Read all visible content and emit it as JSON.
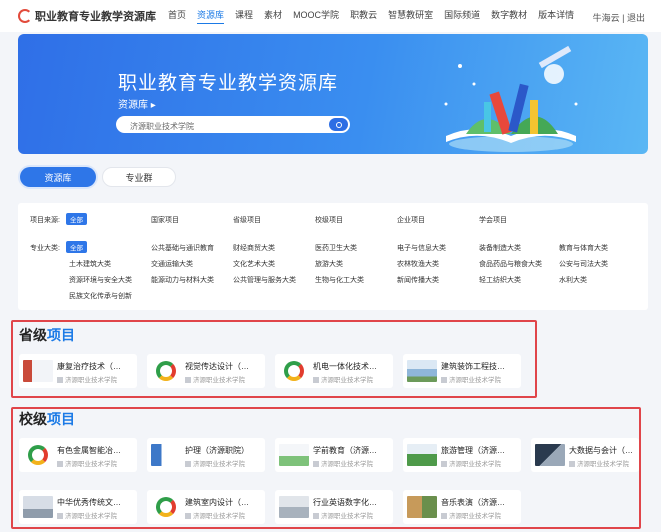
{
  "nav": {
    "logo": "职业教育专业教学资源库",
    "items": [
      "首页",
      "资源库",
      "课程",
      "素材",
      "MOOC学院",
      "职教云",
      "智慧教研室",
      "国际频道",
      "数字教材",
      "版本详情"
    ],
    "active_index": 1,
    "user": "牛海云 | 退出"
  },
  "banner": {
    "title": "职业教育专业教学资源库",
    "subtitle": "资源库 ▸",
    "search_value": "济源职业技术学院"
  },
  "tabs": [
    "资源库",
    "专业群"
  ],
  "filter": {
    "source_label": "项目来源:",
    "source_all": "全部",
    "source_options": [
      "国家项目",
      "省级项目",
      "校级项目",
      "企业项目",
      "学会项目"
    ],
    "category_label": "专业大类:",
    "category_all": "全部",
    "categories": [
      [
        "公共基础与通识教育",
        "财经商贸大类",
        "医药卫生大类",
        "电子与信息大类",
        "装备制造大类",
        "教育与体育大类"
      ],
      [
        "土木建筑大类",
        "交通运输大类",
        "文化艺术大类",
        "旅游大类",
        "农林牧渔大类",
        "食品药品与粮食大类",
        "公安与司法大类"
      ],
      [
        "资源环境与安全大类",
        "能源动力与材料大类",
        "公共管理与服务大类",
        "生物与化工大类",
        "新闻传播大类",
        "轻工纺织大类",
        "水利大类"
      ],
      [
        "民族文化传承与创新"
      ]
    ]
  },
  "provincial": {
    "title_a": "省级",
    "title_b": "项目",
    "cards": [
      {
        "name": "康复治疗技术（…",
        "school": "济源职业技术学院"
      },
      {
        "name": "视觉传达设计（…",
        "school": "济源职业技术学院"
      },
      {
        "name": "机电一体化技术…",
        "school": "济源职业技术学院"
      },
      {
        "name": "建筑装饰工程技…",
        "school": "济源职业技术学院"
      }
    ]
  },
  "school": {
    "title_a": "校级",
    "title_b": "项目",
    "cards": [
      {
        "name": "有色金属智能冶…",
        "school": "济源职业技术学院"
      },
      {
        "name": "护理（济源职院）",
        "school": "济源职业技术学院"
      },
      {
        "name": "学前教育（济源…",
        "school": "济源职业技术学院"
      },
      {
        "name": "旅游管理（济源…",
        "school": "济源职业技术学院"
      },
      {
        "name": "大数据与会计（…",
        "school": "济源职业技术学院"
      },
      {
        "name": "中华优秀传统文…",
        "school": "济源职业技术学院"
      },
      {
        "name": "建筑室内设计（…",
        "school": "济源职业技术学院"
      },
      {
        "name": "行业英语数字化…",
        "school": "济源职业技术学院"
      },
      {
        "name": "音乐表演（济源…",
        "school": "济源职业技术学院"
      }
    ]
  },
  "colors": {
    "brand_blue": "#2e76e8",
    "highlight_red": "#e0454a"
  }
}
